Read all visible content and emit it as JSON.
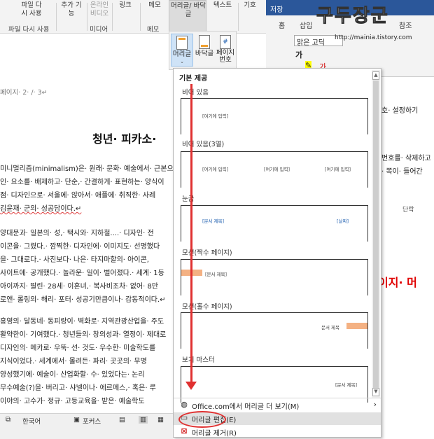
{
  "ribbon": {
    "groups": [
      {
        "label": "파일 다\n시 사용"
      },
      {
        "label": "추가 기\n능"
      },
      {
        "label": "온라인\n비디오"
      },
      {
        "label": "링크"
      },
      {
        "label": "메모"
      },
      {
        "label": "머리글/\n바닥글"
      },
      {
        "label": "텍스트"
      },
      {
        "label": "기호"
      }
    ],
    "group_names": {
      "reuse": "파일 다시 사용",
      "media": "미디어",
      "memo": "메모"
    },
    "hf_buttons": [
      {
        "label": "머리글",
        "icon": "header-icon"
      },
      {
        "label": "바닥글",
        "icon": "footer-icon"
      },
      {
        "label": "페이지\n번호",
        "icon": "page-number-icon"
      }
    ]
  },
  "right_window": {
    "title_fragment": "저장",
    "tabs": [
      "홈",
      "삽입",
      "참조"
    ],
    "font_name": "맑은 고딕",
    "paragraph_group": "단락"
  },
  "watermark": {
    "text": "구두장군",
    "url": "http://mainia.tistory.com"
  },
  "document": {
    "page_info": "페이지· 2· /· 3↵",
    "title": "청년· 피카소·",
    "lines": [
      "미니멀리즘(minimalism)은· 원래· 문화· 예술에서· 근본으",
      "인· 요소를· 배제하고· 단순,· 간결하게· 표현하는· 양식이",
      "점· 디자인으로· 서울에· 앉아서· 애플에· 취직한· 사례",
      "김윤재· 군의· 성공담이다.↵",
      "",
      "양대문과· 일본의· 성,· 택시와· 지하철....· 디자인· 전",
      "이콘을· 그렸다.· 깜찍한· 디자인에· 이미지도· 선명했다",
      "을· 그대로다.· 사진보다· 나은· 타지마할의· 아이콘,",
      "사이트에· 공개했다.· 놀라운· 일이· 벌어졌다.· 세계· 1등",
      "아이까지· 딸린· 28세· 이혼녀,· 복사비조차· 없어· 8만",
      "로앤· 롤링의· 해리· 포터· 성공기만큼이나· 감동적이다.↵",
      "",
      "홍영의· 달동네· 동피랑이· 벽화로· 지역관광산업을· 주도",
      "활약한이· 기여했다.· 청년들의· 창의성과· 열정이· 제대로",
      "디자인의· 메카로· 우뚝· 선· 것도· 우수한· 미술학도를",
      "지식이었다.· 세계에서· 몰려든· 파리· 곳곳의· 무명",
      "양성했기에· 예술이· 산업화할· 수· 있었다는· 논리",
      "무수예술(?)을· 버리고· 샤넬이나· 에르메스,· 혹은· 루",
      "이야의· 고수가· 정규· 고등교육을· 받은· 예술학도"
    ],
    "right_lines": {
      "line1": "호· 설정하기",
      "line2": "번호를· 삭제하고",
      "line3": "· 쪽이· 들어간",
      "big": "이지· 머"
    }
  },
  "gallery": {
    "header": "기본 제공",
    "sections": [
      {
        "label": "비어 있음",
        "placeholders": [
          "[여기에 입력]"
        ]
      },
      {
        "label": "비어 있음(3열)",
        "placeholders": [
          "[여기에 입력]",
          "[여기에 입력]",
          "[여기에 입력]"
        ]
      },
      {
        "label": "눈금",
        "placeholders": [
          "[문서 제목]",
          "[날짜]"
        ]
      },
      {
        "label": "모션(짝수 페이지)",
        "placeholders": [
          "[문서 제목]"
        ]
      },
      {
        "label": "모션(홀수 페이지)",
        "placeholders": [
          "문서 제목"
        ]
      },
      {
        "label": "보기 마스터",
        "placeholders": [
          "[문서 제목]"
        ]
      }
    ],
    "menu": [
      {
        "label": "Office.com에서 머리글 더 보기(M)",
        "icon": "globe-icon"
      },
      {
        "label": "머리글 편집(E)",
        "icon": "edit-header-icon"
      },
      {
        "label": "머리글 제거(R)",
        "icon": "remove-header-icon"
      }
    ]
  },
  "statusbar": {
    "language": "한국어",
    "focus": "포커스"
  },
  "colors": {
    "accent": "#2b579a",
    "annotation": "#e03030",
    "motion_swatch": "#f4b183"
  }
}
